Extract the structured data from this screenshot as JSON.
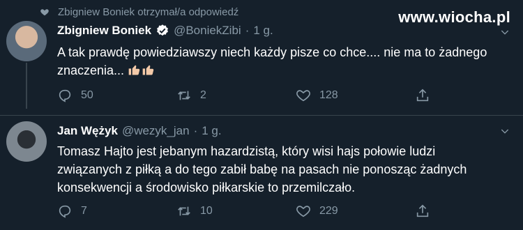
{
  "context": {
    "text": "Zbigniew Boniek otrzymał/a odpowiedź",
    "icon": "heart-icon"
  },
  "watermark": "www.wiocha.pl",
  "tweets": [
    {
      "name": "Zbigniew Boniek",
      "verified": true,
      "handle": "@BoniekZibi",
      "dot": "·",
      "time": "1 g.",
      "text": "A tak prawdę powiedziawszy niech każdy pisze co chce.... nie ma to żadnego znaczenia...",
      "emoji": [
        "thumbs-up-icon",
        "thumbs-up-icon"
      ],
      "replies": "50",
      "retweets": "2",
      "likes": "128"
    },
    {
      "name": "Jan Wężyk",
      "verified": false,
      "handle": "@wezyk_jan",
      "dot": "·",
      "time": "1 g.",
      "text": "Tomasz Hajto jest jebanym hazardzistą, który wisi hajs połowie ludzi związanych z piłką a do tego zabił babę na pasach nie ponosząc żadnych konsekwencji a środowisko piłkarskie to przemilczało.",
      "replies": "7",
      "retweets": "10",
      "likes": "229"
    }
  ],
  "colors": {
    "background": "#15202b",
    "muted": "#8899a6",
    "verified": "#ffffff",
    "divider": "#38444d"
  }
}
